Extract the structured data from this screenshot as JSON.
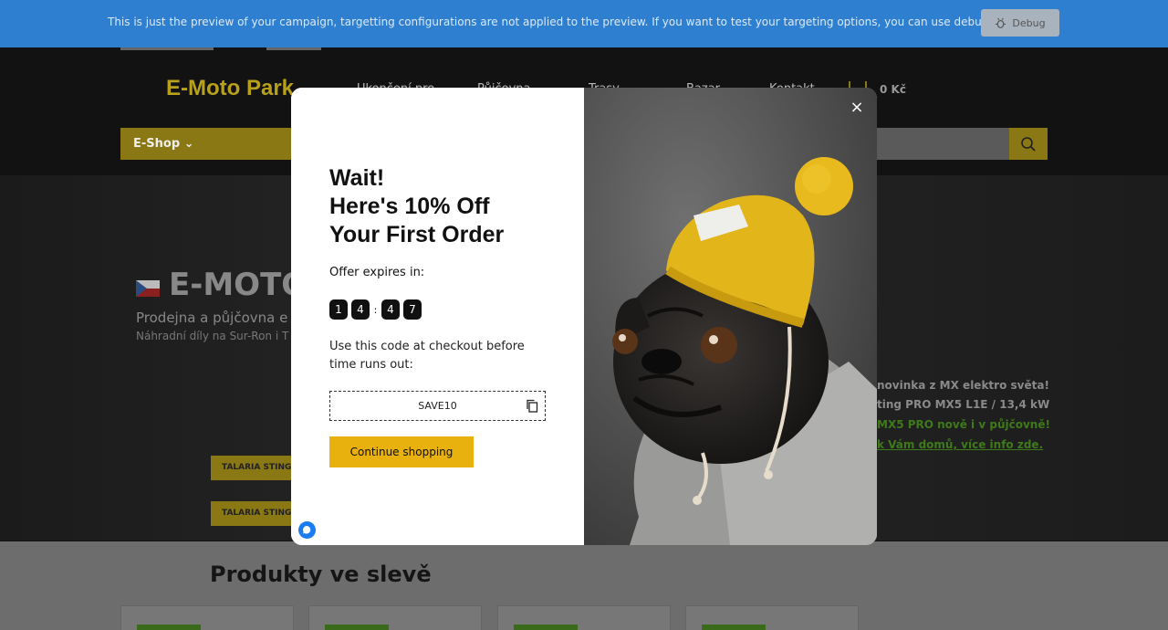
{
  "banner": {
    "text": "This is just the preview of your campaign, targetting configurations are not applied to the preview. If you want to test your targeting options, you can use debug mode.",
    "debug_label": "Debug"
  },
  "site": {
    "logo": "E-Moto Park",
    "nav": [
      "Ukončení pro",
      "Půjčovna",
      "Trasy",
      "Bazar",
      "Kontakt"
    ],
    "cart": "0 Kč",
    "eshop": "E-Shop ⌄",
    "hero_title": "E-MOTO",
    "hero_sub": "Prodejna a půjčovna e",
    "hero_sub2": "Náhradní díly na Sur-Ron i T",
    "hero_btn1": "TALARIA STING PRO",
    "hero_btn2": "TALARIA STING PRO",
    "right_lines": [
      "novinka z MX elektro světa!",
      "ting PRO MX5 L1E / 13,4 kW",
      "MX5 PRO nově i v půjčovně!",
      "k Vám domů, více info zde."
    ],
    "products_title": "Produkty ve slevě"
  },
  "modal": {
    "headline": [
      "Wait!",
      "Here's 10% Off",
      "Your First Order"
    ],
    "expires_label": "Offer expires in:",
    "timer": [
      "1",
      "4",
      "4",
      "7"
    ],
    "instructions": "Use this code at checkout before time runs out:",
    "coupon_code": "SAVE10",
    "cta_label": "Continue shopping",
    "close_label": "×"
  },
  "colors": {
    "banner": "#2f7fd1",
    "cta": "#e8b10e",
    "hat": "#e2b51a"
  }
}
